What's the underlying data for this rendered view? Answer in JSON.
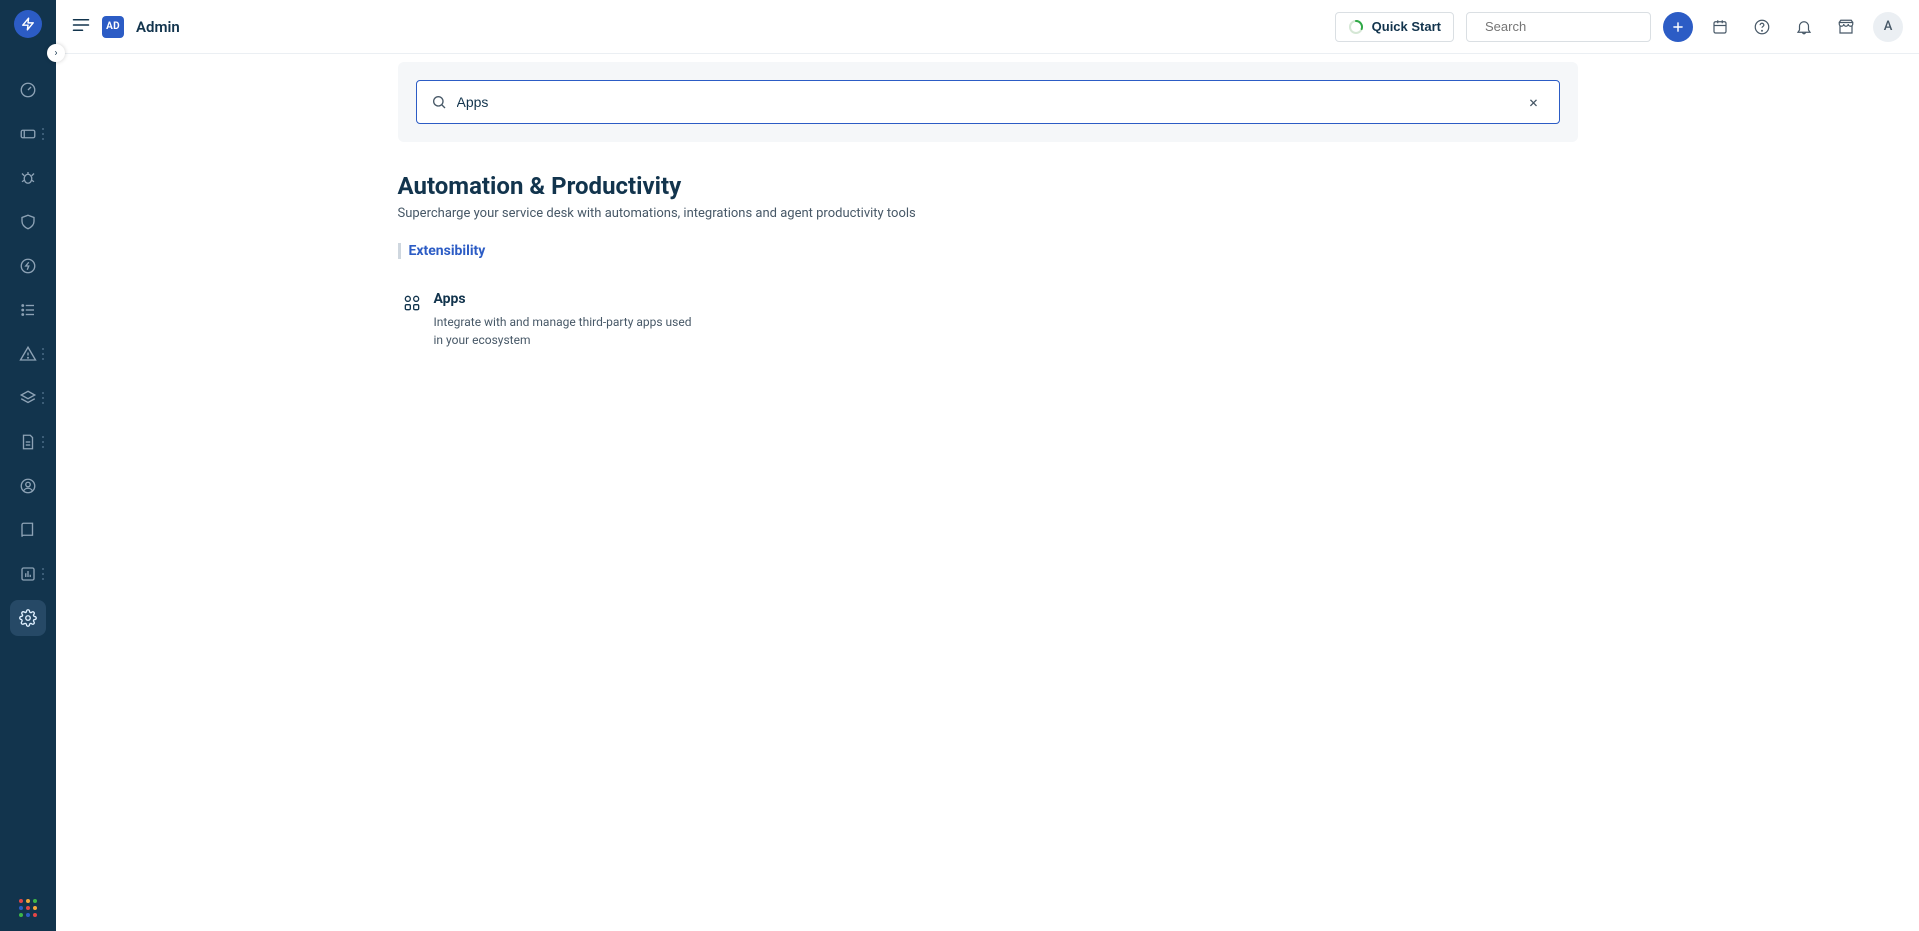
{
  "header": {
    "workspace_badge": "AD",
    "title": "Admin",
    "quick_start_label": "Quick Start",
    "search_placeholder": "Search",
    "avatar_letter": "A"
  },
  "page_search": {
    "value": "Apps"
  },
  "section": {
    "title": "Automation & Productivity",
    "subtitle": "Supercharge your service desk with automations, integrations and agent productivity tools",
    "group_label": "Extensibility"
  },
  "card": {
    "title": "Apps",
    "description": "Integrate with and manage third-party apps used in your ecosystem"
  },
  "sidebar_icons": [
    "dashboard",
    "tickets",
    "problems",
    "changes",
    "releases",
    "tasks",
    "alerts",
    "assets",
    "contracts",
    "people",
    "solutions",
    "reports",
    "settings"
  ],
  "app_launcher_colors": [
    "#e34646",
    "#f4a93a",
    "#3cb648",
    "#2c5cc5",
    "#e34646",
    "#f4a93a",
    "#3cb648",
    "#2c5cc5",
    "#e34646"
  ]
}
